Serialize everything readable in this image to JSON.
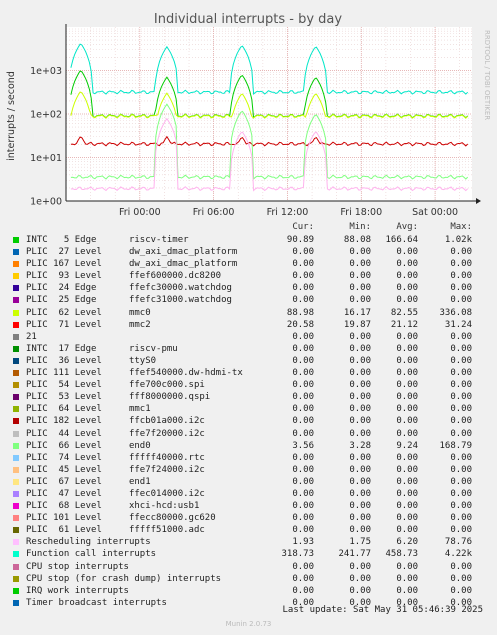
{
  "chart_data": {
    "type": "line",
    "title": "Individual interrupts - by day",
    "ylabel": "interrupts / second",
    "yscale": "log",
    "ylim": [
      1,
      10000
    ],
    "yticks": [
      {
        "value": 1,
        "label": "1e+00"
      },
      {
        "value": 10,
        "label": "1e+01"
      },
      {
        "value": 100,
        "label": "1e+02"
      },
      {
        "value": 1000,
        "label": "1e+03"
      }
    ],
    "xticks": [
      {
        "value": 6,
        "label": "Fri 00:00"
      },
      {
        "value": 12,
        "label": "Fri 06:00"
      },
      {
        "value": 18,
        "label": "Fri 12:00"
      },
      {
        "value": 24,
        "label": "Fri 18:00"
      },
      {
        "value": 30,
        "label": "Sat 00:00"
      }
    ],
    "xlim": [
      0,
      33
    ],
    "grid": true,
    "side_label": "RRDTOOL / TOBI OETIKER",
    "series_approx": [
      {
        "name": "Function call interrupts",
        "color": "#00e6c8",
        "base": 318.73,
        "spikes": [
          [
            1.2,
            4220
          ],
          [
            8.2,
            3500
          ],
          [
            14.3,
            3800
          ],
          [
            20.3,
            3600
          ]
        ]
      },
      {
        "name": "INTC 5 Edge riscv-timer",
        "color": "#00cc00",
        "base": 90.89,
        "spikes": [
          [
            1.2,
            1020
          ],
          [
            8.2,
            700
          ],
          [
            14.3,
            800
          ],
          [
            20.3,
            700
          ]
        ]
      },
      {
        "name": "PLIC 62 Level mmc0",
        "color": "#ccff00",
        "base": 88.98,
        "spikes": [
          [
            1.2,
            336
          ],
          [
            8.2,
            300
          ],
          [
            14.3,
            300
          ],
          [
            20.3,
            300
          ]
        ]
      },
      {
        "name": "PLIC 71 Level mmc2",
        "color": "#cc0000",
        "base": 20.58,
        "spikes": [
          [
            1.2,
            31
          ],
          [
            8.2,
            30
          ],
          [
            14.3,
            30
          ],
          [
            20.3,
            30
          ]
        ]
      },
      {
        "name": "PLIC 66 Level end0",
        "color": "#80ff80",
        "base": 3.56,
        "spikes": [
          [
            8.2,
            168
          ],
          [
            14.3,
            120
          ],
          [
            20.3,
            100
          ]
        ]
      },
      {
        "name": "Rescheduling interrupts",
        "color": "#ffb3ee",
        "base": 1.93,
        "spikes": [
          [
            8.2,
            78
          ],
          [
            14.3,
            40
          ],
          [
            20.3,
            40
          ]
        ]
      }
    ],
    "columns": [
      "Cur:",
      "Min:",
      "Avg:",
      "Max:"
    ],
    "legend": [
      {
        "label": "INTC   5 Edge      riscv-timer",
        "color": "#00cc00",
        "cur": "90.89",
        "min": "88.08",
        "avg": "166.64",
        "max": "1.02k"
      },
      {
        "label": "PLIC  27 Level     dw_axi_dmac_platform",
        "color": "#0066b3",
        "cur": "0.00",
        "min": "0.00",
        "avg": "0.00",
        "max": "0.00"
      },
      {
        "label": "PLIC 167 Level     dw_axi_dmac_platform",
        "color": "#ff8000",
        "cur": "0.00",
        "min": "0.00",
        "avg": "0.00",
        "max": "0.00"
      },
      {
        "label": "PLIC  93 Level     ffef600000.dc8200",
        "color": "#ffcc00",
        "cur": "0.00",
        "min": "0.00",
        "avg": "0.00",
        "max": "0.00"
      },
      {
        "label": "PLIC  24 Edge      ffefc30000.watchdog",
        "color": "#330099",
        "cur": "0.00",
        "min": "0.00",
        "avg": "0.00",
        "max": "0.00"
      },
      {
        "label": "PLIC  25 Edge      ffefc31000.watchdog",
        "color": "#990099",
        "cur": "0.00",
        "min": "0.00",
        "avg": "0.00",
        "max": "0.00"
      },
      {
        "label": "PLIC  62 Level     mmc0",
        "color": "#ccff00",
        "cur": "88.98",
        "min": "16.17",
        "avg": "82.55",
        "max": "336.08"
      },
      {
        "label": "PLIC  71 Level     mmc2",
        "color": "#ff0000",
        "cur": "20.58",
        "min": "19.87",
        "avg": "21.12",
        "max": "31.24"
      },
      {
        "label": "21",
        "color": "#808080",
        "cur": "0.00",
        "min": "0.00",
        "avg": "0.00",
        "max": "0.00"
      },
      {
        "label": "INTC  17 Edge      riscv-pmu",
        "color": "#008f00",
        "cur": "0.00",
        "min": "0.00",
        "avg": "0.00",
        "max": "0.00"
      },
      {
        "label": "PLIC  36 Level     ttyS0",
        "color": "#00487d",
        "cur": "0.00",
        "min": "0.00",
        "avg": "0.00",
        "max": "0.00"
      },
      {
        "label": "PLIC 111 Level     ffef540000.dw-hdmi-tx",
        "color": "#b35a00",
        "cur": "0.00",
        "min": "0.00",
        "avg": "0.00",
        "max": "0.00"
      },
      {
        "label": "PLIC  54 Level     ffe700c000.spi",
        "color": "#b38f00",
        "cur": "0.00",
        "min": "0.00",
        "avg": "0.00",
        "max": "0.00"
      },
      {
        "label": "PLIC  53 Level     fff8000000.qspi",
        "color": "#6b006b",
        "cur": "0.00",
        "min": "0.00",
        "avg": "0.00",
        "max": "0.00"
      },
      {
        "label": "PLIC  64 Level     mmc1",
        "color": "#8fb300",
        "cur": "0.00",
        "min": "0.00",
        "avg": "0.00",
        "max": "0.00"
      },
      {
        "label": "PLIC 182 Level     ffcb01a000.i2c",
        "color": "#b30000",
        "cur": "0.00",
        "min": "0.00",
        "avg": "0.00",
        "max": "0.00"
      },
      {
        "label": "PLIC  44 Level     ffe7f20000.i2c",
        "color": "#bebebe",
        "cur": "0.00",
        "min": "0.00",
        "avg": "0.00",
        "max": "0.00"
      },
      {
        "label": "PLIC  66 Level     end0",
        "color": "#80ff80",
        "cur": "3.56",
        "min": "3.28",
        "avg": "9.24",
        "max": "168.79"
      },
      {
        "label": "PLIC  74 Level     fffff40000.rtc",
        "color": "#80c9ff",
        "cur": "0.00",
        "min": "0.00",
        "avg": "0.00",
        "max": "0.00"
      },
      {
        "label": "PLIC  45 Level     ffe7f24000.i2c",
        "color": "#ffc080",
        "cur": "0.00",
        "min": "0.00",
        "avg": "0.00",
        "max": "0.00"
      },
      {
        "label": "PLIC  67 Level     end1",
        "color": "#ffe680",
        "cur": "0.00",
        "min": "0.00",
        "avg": "0.00",
        "max": "0.00"
      },
      {
        "label": "PLIC  47 Level     ffec014000.i2c",
        "color": "#aa80ff",
        "cur": "0.00",
        "min": "0.00",
        "avg": "0.00",
        "max": "0.00"
      },
      {
        "label": "PLIC  68 Level     xhci-hcd:usb1",
        "color": "#ee00cc",
        "cur": "0.00",
        "min": "0.00",
        "avg": "0.00",
        "max": "0.00"
      },
      {
        "label": "PLIC 101 Level     ffecc80000.gc620",
        "color": "#ff8080",
        "cur": "0.00",
        "min": "0.00",
        "avg": "0.00",
        "max": "0.00"
      },
      {
        "label": "PLIC  61 Level     fffff51000.adc",
        "color": "#666600",
        "cur": "0.00",
        "min": "0.00",
        "avg": "0.00",
        "max": "0.00"
      },
      {
        "label": "Rescheduling interrupts",
        "color": "#ffbfff",
        "cur": "1.93",
        "min": "1.75",
        "avg": "6.20",
        "max": "78.76"
      },
      {
        "label": "Function call interrupts",
        "color": "#00ffcc",
        "cur": "318.73",
        "min": "241.77",
        "avg": "458.73",
        "max": "4.22k"
      },
      {
        "label": "CPU stop interrupts",
        "color": "#cc6699",
        "cur": "0.00",
        "min": "0.00",
        "avg": "0.00",
        "max": "0.00"
      },
      {
        "label": "CPU stop (for crash dump) interrupts",
        "color": "#999900",
        "cur": "0.00",
        "min": "0.00",
        "avg": "0.00",
        "max": "0.00"
      },
      {
        "label": "IRQ work interrupts",
        "color": "#00cc00",
        "cur": "0.00",
        "min": "0.00",
        "avg": "0.00",
        "max": "0.00"
      },
      {
        "label": "Timer broadcast interrupts",
        "color": "#0066b3",
        "cur": "0.00",
        "min": "0.00",
        "avg": "0.00",
        "max": "0.00"
      }
    ]
  },
  "footer": {
    "last_update": "Last update: Sat May 31 05:46:39 2025",
    "munin": "Munin 2.0.73"
  }
}
